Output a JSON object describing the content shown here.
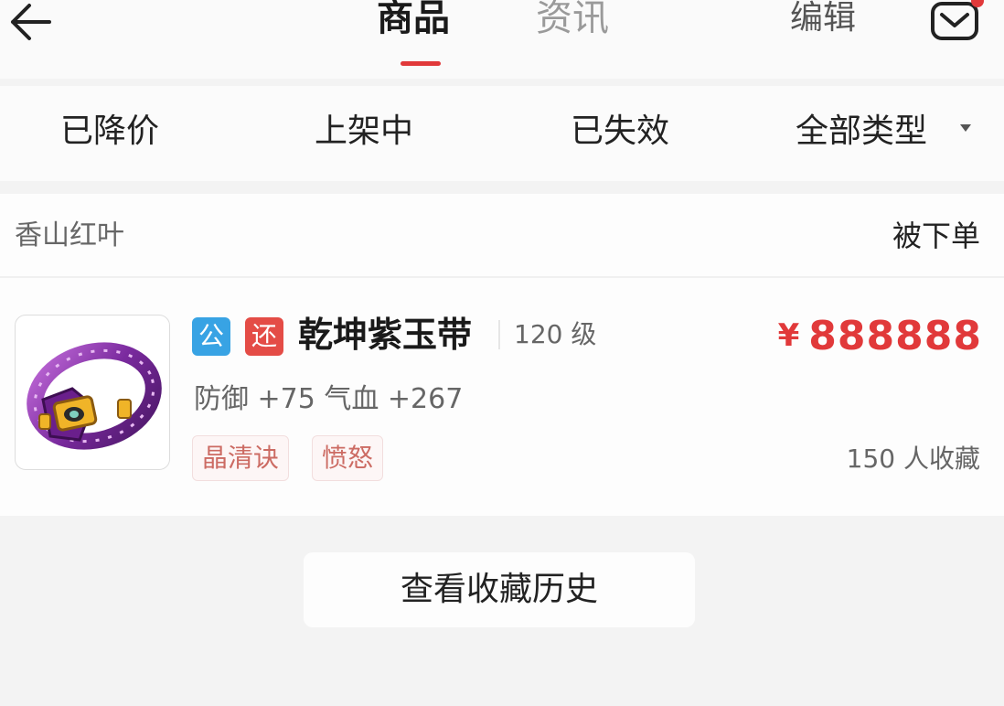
{
  "header": {
    "tabs": [
      {
        "label": "商品",
        "active": true
      },
      {
        "label": "资讯",
        "active": false
      }
    ],
    "edit_label": "编辑",
    "accent_color": "#e1393a"
  },
  "filters": {
    "items": [
      "已降价",
      "上架中",
      "已失效",
      "全部类型"
    ]
  },
  "card": {
    "seller": "香山红叶",
    "status": "被下单",
    "item": {
      "badges": [
        "公",
        "还"
      ],
      "name": "乾坤紫玉带",
      "level": "120 级",
      "price_currency": "¥",
      "price_value": "888888",
      "attributes": "防御 +75 气血 +267",
      "tags": [
        "晶清诀",
        "愤怒"
      ],
      "favorites": "150 人收藏",
      "icon": "purple-belt-icon"
    }
  },
  "history_button_label": "查看收藏历史"
}
